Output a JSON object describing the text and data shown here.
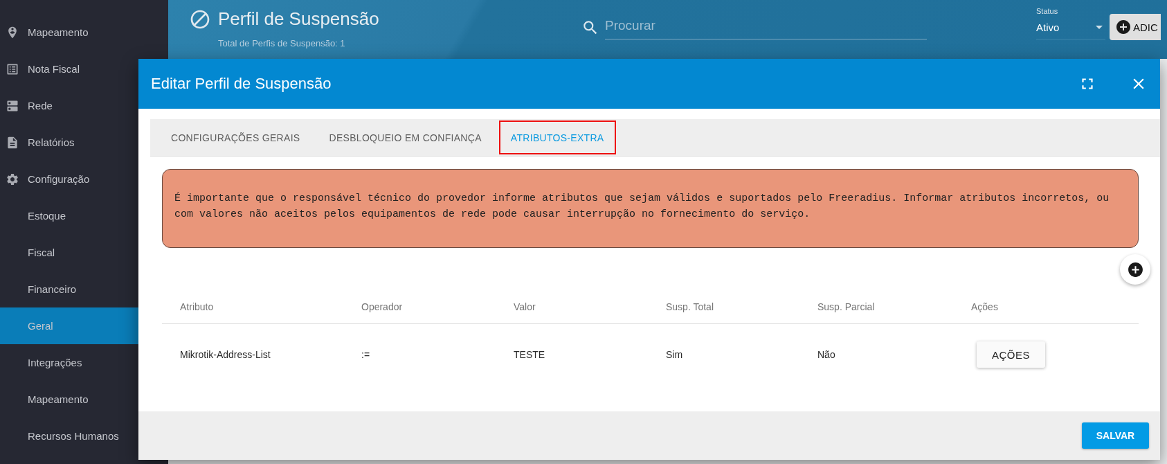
{
  "sidebar": {
    "items": [
      {
        "label": "Mapeamento",
        "kind": "section",
        "selected": false
      },
      {
        "label": "Nota Fiscal",
        "kind": "section",
        "selected": false
      },
      {
        "label": "Rede",
        "kind": "section",
        "selected": false
      },
      {
        "label": "Relatórios",
        "kind": "section",
        "selected": false
      },
      {
        "label": "Configuração",
        "kind": "section",
        "selected": false
      },
      {
        "label": "Estoque",
        "kind": "subitem",
        "selected": false
      },
      {
        "label": "Fiscal",
        "kind": "subitem",
        "selected": false
      },
      {
        "label": "Financeiro",
        "kind": "subitem",
        "selected": false
      },
      {
        "label": "Geral",
        "kind": "subitem",
        "selected": true
      },
      {
        "label": "Integrações",
        "kind": "subitem",
        "selected": false
      },
      {
        "label": "Mapeamento",
        "kind": "subitem",
        "selected": false
      },
      {
        "label": "Recursos Humanos",
        "kind": "subitem",
        "selected": false
      }
    ]
  },
  "header": {
    "title": "Perfil de Suspensão",
    "subtitle": "Total de Perfis de Suspensão: 1",
    "search": {
      "placeholder": "Procurar"
    },
    "status": {
      "label": "Status",
      "value": "Ativo"
    },
    "add_button": "ADIC"
  },
  "dialog": {
    "title": "Editar Perfil de Suspensão",
    "tabs": [
      {
        "label": "CONFIGURAÇÕES GERAIS",
        "selected": false,
        "highlighted": false
      },
      {
        "label": "DESBLOQUEIO EM CONFIANÇA",
        "selected": false,
        "highlighted": false
      },
      {
        "label": "ATRIBUTOS-EXTRA",
        "selected": true,
        "highlighted": true
      }
    ],
    "warning": "É importante que o responsável técnico do provedor informe atributos que sejam válidos e suportados pelo Freeradius. Informar atributos incorretos, ou com valores não aceitos pelos equipamentos de rede pode causar interrupção no fornecimento do serviço.",
    "table": {
      "columns": [
        "Atributo",
        "Operador",
        "Valor",
        "Susp. Total",
        "Susp. Parcial",
        "Ações"
      ],
      "rows": [
        {
          "cells": [
            "Mikrotik-Address-List",
            ":=",
            "TESTE",
            "Sim",
            "Não"
          ],
          "action": "AÇÕES"
        }
      ]
    },
    "save_button": "SALVAR"
  }
}
